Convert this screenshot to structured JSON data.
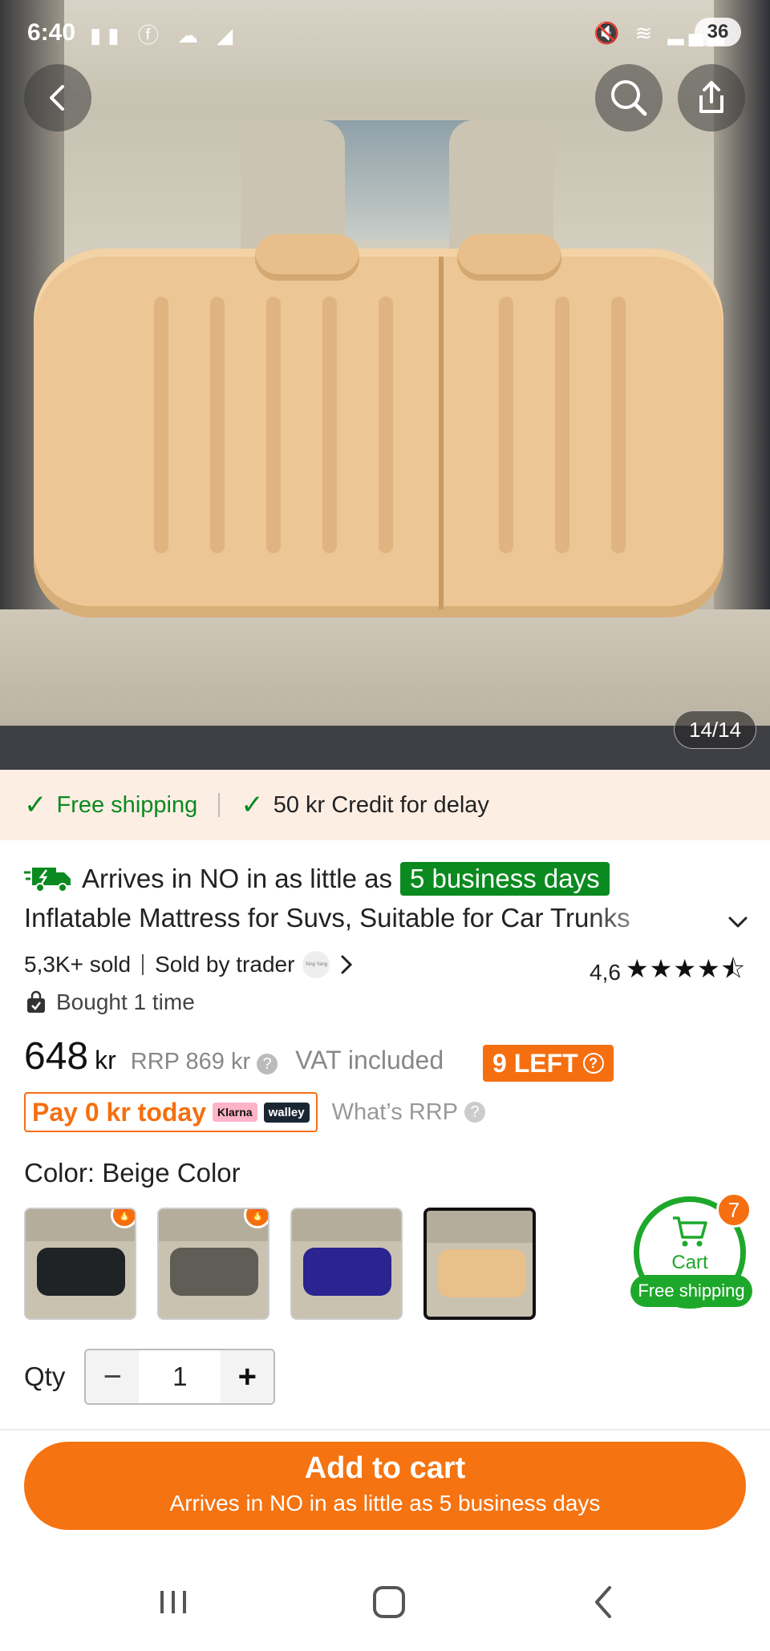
{
  "status_bar": {
    "time": "6:40",
    "battery": "36"
  },
  "gallery": {
    "counter": "14/14"
  },
  "shipping_strip": {
    "free_shipping": "Free shipping",
    "credit": "50 kr Credit for delay"
  },
  "arrival": {
    "text": "Arrives in NO in as little as",
    "days": "5 business days"
  },
  "product": {
    "title": "Inflatable Mattress for Suvs, Suitable for Car Trunks",
    "sold": "5,3K+ sold",
    "sold_by": "Sold by trader",
    "trader_logo_text": "Xing Yang",
    "rating": "4,6",
    "stars": "★★★★⯪",
    "bought": "Bought 1 time"
  },
  "pricing": {
    "price": "648",
    "currency": "kr",
    "rrp": "RRP 869 kr",
    "vat": "VAT included",
    "left_badge": "9 LEFT",
    "pay_today": "Pay 0 kr today",
    "klarna": "Klarna",
    "walley": "walley",
    "whats_rrp": "What’s RRP"
  },
  "color": {
    "label": "Color: Beige Color",
    "options": [
      {
        "name": "black",
        "color": "#1f2326",
        "hot": true
      },
      {
        "name": "gray",
        "color": "#5f5d55",
        "hot": true
      },
      {
        "name": "blue",
        "color": "#2a2390",
        "hot": false
      },
      {
        "name": "beige",
        "color": "#e8c08a",
        "hot": false,
        "selected": true
      }
    ]
  },
  "cart": {
    "label": "Cart",
    "count": "7",
    "free_shipping": "Free shipping"
  },
  "quantity": {
    "label": "Qty",
    "value": "1",
    "minus": "−",
    "plus": "+"
  },
  "add_to_cart": {
    "label": "Add to cart",
    "sub": "Arrives in NO in as little as 5 business days"
  },
  "colors": {
    "accent_orange": "#f57310",
    "green": "#0a8a1f",
    "cart_green": "#1ea82b"
  }
}
